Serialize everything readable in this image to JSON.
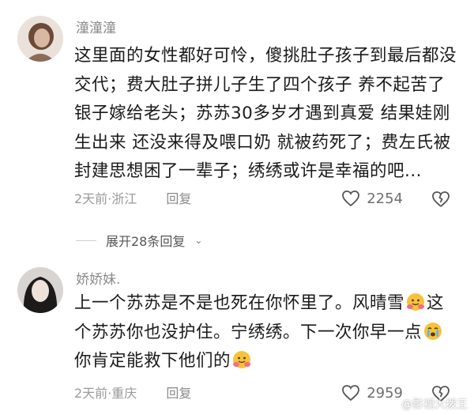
{
  "comments": [
    {
      "username": "潼潼潼",
      "avatar": "avatar-1",
      "text": "这里面的女性都好可怜，傻挑肚子孩子到最后都没交代；费大肚子拼儿子生了四个孩子 养不起苦了银子嫁给老头；苏苏30多岁才遇到真爱 结果娃刚生出来 还没来得及喂口奶 就被药死了；费左氏被封建思想困了一辈子；绣绣或许是幸福的吧...",
      "time": "2天前",
      "location": "浙江",
      "reply_label": "回复",
      "likes": "2254"
    },
    {
      "username": "娇娇妹.",
      "avatar": "avatar-2",
      "text_parts": [
        "上一个苏苏是不是也死在你怀里了。风晴雪",
        "这个苏苏你也没护住。宁绣绣。下一次你早一点",
        "你肯定能救下他们的"
      ],
      "emojis": [
        "hug-emoji",
        "crying-emoji",
        "hug-emoji"
      ],
      "time": "2天前",
      "location": "重庆",
      "reply_label": "回复",
      "likes": "2959"
    }
  ],
  "expand_replies": "展开28条回复",
  "watermark": "@影视大拨王"
}
